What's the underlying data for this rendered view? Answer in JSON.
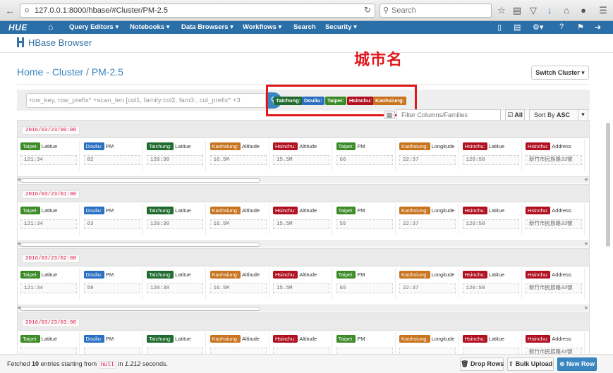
{
  "browser": {
    "url": "127.0.0.1:8000/hbase/#Cluster/PM-2.5",
    "search_placeholder": "Search"
  },
  "navbar": {
    "logo": "HUE",
    "items": [
      "Query Editors",
      "Notebooks",
      "Data Browsers",
      "Workflows",
      "Search",
      "Security"
    ]
  },
  "app": {
    "title": "HBase Browser",
    "annotation": "城市名"
  },
  "breadcrumb": {
    "home": "Home",
    "cluster": "Cluster",
    "table": "PM-2.5",
    "sep_dash": " - ",
    "sep_slash": " / "
  },
  "switch_cluster_label": "Switch Cluster",
  "search": {
    "placeholder": "row_key, row_prefix* +scan_len [col1, family:col2, fam3:, col_prefix* +3"
  },
  "city_tags": [
    {
      "label": "Taichung:",
      "color": "#1f6b2e"
    },
    {
      "label": "Douliu:",
      "color": "#2a6fc1"
    },
    {
      "label": "Taipei:",
      "color": "#3a8a26"
    },
    {
      "label": "Hsinchu:",
      "color": "#b01020"
    },
    {
      "label": "Kaohsiung:",
      "color": "#c8731e"
    }
  ],
  "filter": {
    "placeholder": "Filter Columns/Families",
    "all_label": "All",
    "sort_label": "Sort By",
    "sort_value": "ASC"
  },
  "rows": [
    {
      "key": "2016/03/23/00:00",
      "cells": [
        {
          "family": "Taipei:",
          "column": "Latitue",
          "value": "121:34"
        },
        {
          "family": "Douliu:",
          "column": "PM",
          "value": "82"
        },
        {
          "family": "Taichung:",
          "column": "Latitue",
          "value": "120:38"
        },
        {
          "family": "Kaohsiung:",
          "column": "Altitude",
          "value": "16.5M"
        },
        {
          "family": "Hsinchu:",
          "column": "Altitude",
          "value": "15.5M"
        },
        {
          "family": "Taipei:",
          "column": "PM",
          "value": "66"
        },
        {
          "family": "Kaohsiung:",
          "column": "Longitude",
          "value": "22:37"
        },
        {
          "family": "Hsinchu:",
          "column": "Latitue",
          "value": "120:58"
        },
        {
          "family": "Hsinchu:",
          "column": "Address",
          "value": "新竹市民族路33號"
        }
      ]
    },
    {
      "key": "2016/03/23/01:00",
      "cells": [
        {
          "family": "Taipei:",
          "column": "Latitue",
          "value": "121:34"
        },
        {
          "family": "Douliu:",
          "column": "PM",
          "value": "63"
        },
        {
          "family": "Taichung:",
          "column": "Latitue",
          "value": "120:38"
        },
        {
          "family": "Kaohsiung:",
          "column": "Altitude",
          "value": "16.5M"
        },
        {
          "family": "Hsinchu:",
          "column": "Altitude",
          "value": "15.5M"
        },
        {
          "family": "Taipei:",
          "column": "PM",
          "value": "55"
        },
        {
          "family": "Kaohsiung:",
          "column": "Longitude",
          "value": "22:37"
        },
        {
          "family": "Hsinchu:",
          "column": "Latitue",
          "value": "120:58"
        },
        {
          "family": "Hsinchu:",
          "column": "Address",
          "value": "新竹市民族路33號"
        }
      ]
    },
    {
      "key": "2016/03/23/02:00",
      "cells": [
        {
          "family": "Taipei:",
          "column": "Latitue",
          "value": "121:34"
        },
        {
          "family": "Douliu:",
          "column": "PM",
          "value": "59"
        },
        {
          "family": "Taichung:",
          "column": "Latitue",
          "value": "120:38"
        },
        {
          "family": "Kaohsiung:",
          "column": "Altitude",
          "value": "16.5M"
        },
        {
          "family": "Hsinchu:",
          "column": "Altitude",
          "value": "15.5M"
        },
        {
          "family": "Taipei:",
          "column": "PM",
          "value": "65"
        },
        {
          "family": "Kaohsiung:",
          "column": "Longitude",
          "value": "22:37"
        },
        {
          "family": "Hsinchu:",
          "column": "Latitue",
          "value": "120:58"
        },
        {
          "family": "Hsinchu:",
          "column": "Address",
          "value": "新竹市民族路33號"
        }
      ]
    },
    {
      "key": "2016/03/23/03:00",
      "cells": [
        {
          "family": "Taipei:",
          "column": "Latitue",
          "value": ""
        },
        {
          "family": "Douliu:",
          "column": "PM",
          "value": ""
        },
        {
          "family": "Taichung:",
          "column": "Latitue",
          "value": ""
        },
        {
          "family": "Kaohsiung:",
          "column": "Altitude",
          "value": ""
        },
        {
          "family": "Hsinchu:",
          "column": "Altitude",
          "value": ""
        },
        {
          "family": "Taipei:",
          "column": "PM",
          "value": ""
        },
        {
          "family": "Kaohsiung:",
          "column": "Longitude",
          "value": ""
        },
        {
          "family": "Hsinchu:",
          "column": "Latitue",
          "value": ""
        },
        {
          "family": "Hsinchu:",
          "column": "Address",
          "value": "新竹市民族路33號"
        }
      ]
    }
  ],
  "footer": {
    "fetched_prefix": "Fetched",
    "count": "10",
    "entries_text": "entries starting from",
    "start": "null",
    "in_text": "in",
    "seconds": "1.212",
    "seconds_suffix": "seconds.",
    "drop_rows": "Drop Rows",
    "bulk_upload": "Bulk Upload",
    "new_row": "New Row"
  }
}
